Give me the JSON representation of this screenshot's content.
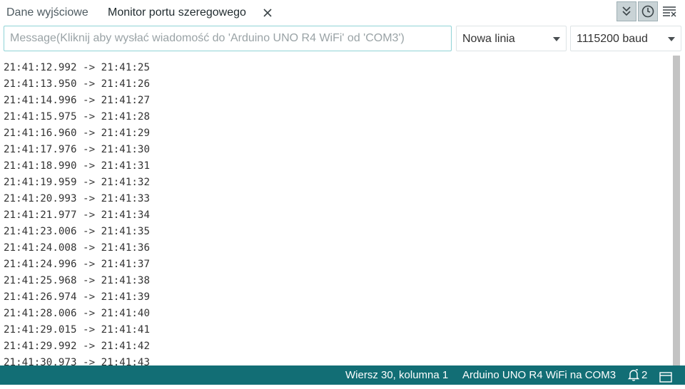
{
  "tabs": [
    {
      "label": "Dane wyjściowe"
    },
    {
      "label": "Monitor portu szeregowego"
    }
  ],
  "toolbar_icons": {
    "autoscroll": "chevrons-down-icon",
    "timestamp": "clock-icon",
    "clear": "clear-output-icon",
    "close": "close-icon"
  },
  "input": {
    "value": "",
    "placeholder": "Message(Kliknij aby wysłać wiadomość do 'Arduino UNO R4 WiFi' od 'COM3')"
  },
  "line_ending": {
    "selected": "Nowa linia"
  },
  "baud": {
    "selected": "1115200 baud"
  },
  "output": {
    "lines": [
      "21:41:12.992 -> 21:41:25",
      "21:41:13.950 -> 21:41:26",
      "21:41:14.996 -> 21:41:27",
      "21:41:15.975 -> 21:41:28",
      "21:41:16.960 -> 21:41:29",
      "21:41:17.976 -> 21:41:30",
      "21:41:18.990 -> 21:41:31",
      "21:41:19.959 -> 21:41:32",
      "21:41:20.993 -> 21:41:33",
      "21:41:21.977 -> 21:41:34",
      "21:41:23.006 -> 21:41:35",
      "21:41:24.008 -> 21:41:36",
      "21:41:24.996 -> 21:41:37",
      "21:41:25.968 -> 21:41:38",
      "21:41:26.974 -> 21:41:39",
      "21:41:28.006 -> 21:41:40",
      "21:41:29.015 -> 21:41:41",
      "21:41:29.992 -> 21:41:42",
      "21:41:30.973 -> 21:41:43"
    ]
  },
  "status": {
    "position": "Wiersz 30, kolumna 1",
    "board": "Arduino UNO R4 WiFi na COM3",
    "notifications": "2"
  },
  "colors": {
    "statusbar": "#126e75",
    "input_border": "#8fd3d6"
  }
}
